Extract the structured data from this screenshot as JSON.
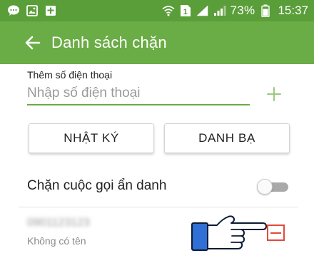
{
  "status_bar": {
    "left_icons": [
      "chat-icon",
      "image-icon",
      "news-icon"
    ],
    "battery_percent": "73%",
    "time": "15:37"
  },
  "app_bar": {
    "title": "Danh sách chặn"
  },
  "add_number": {
    "label": "Thêm số điện thoại",
    "placeholder": "Nhập số điện thoại"
  },
  "buttons": {
    "log_label": "NHẬT KÝ",
    "contacts_label": "DANH BẠ"
  },
  "anonymous_block": {
    "label": "Chặn cuộc gọi ẩn danh",
    "enabled": false
  },
  "blocked_list": [
    {
      "number": "0901123123",
      "name": "Không có tên"
    }
  ],
  "colors": {
    "status_bar": "#5a9e3a",
    "app_bar": "#6aac45",
    "accent": "#6aac45",
    "remove": "#e04a3a",
    "hand_cuff": "#2f6fd6"
  }
}
